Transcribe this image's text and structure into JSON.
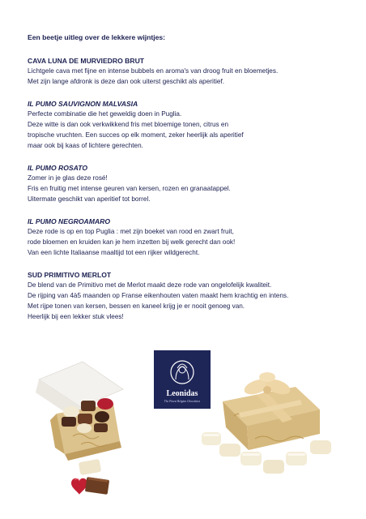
{
  "intro": "Een beetje uitleg over de lekkere wijntjes:",
  "sections": [
    {
      "title": "CAVA LUNA DE MURVIEDRO BRUT",
      "lines": [
        "Lichtgele cava met fijne en intense bubbels en aroma's van droog fruit en bloemetjes.",
        "Met zijn lange afdronk is deze dan ook uiterst geschikt als aperitief."
      ]
    },
    {
      "title": "IL PUMO SAUVIGNON MALVASIA",
      "lines": [
        "Perfecte combinatie die het geweldig doen in Puglia.",
        "Deze witte is dan ook verkwikkend fris met bloemige tonen, citrus en",
        "tropische vruchten. Een succes op elk moment, zeker heerlijk als aperitief",
        "maar ook bij kaas of lichtere gerechten."
      ]
    },
    {
      "title": "IL PUMO ROSATO",
      "lines": [
        "Zomer in je glas deze rosé!",
        "Fris en fruitig met intense geuren van kersen, rozen en granaatappel.",
        "Uitermate geschikt van aperitief tot borrel."
      ]
    },
    {
      "title": "IL PUMO NEGROAMARO",
      "lines": [
        "Deze rode is op en top Puglia : met zijn boeket van rood en zwart fruit,",
        "rode bloemen en kruiden kan je hem inzetten bij welk gerecht dan ook!",
        "Van een lichte Italiaanse maaltijd tot een rijker wildgerecht."
      ]
    },
    {
      "title": "SUD PRIMITIVO MERLOT",
      "lines": [
        "De blend van de Primitivo met de Merlot maakt deze rode van ongelofelijk kwaliteit.",
        "De rijping van 4à5 maanden op Franse eikenhouten vaten maakt hem krachtig en intens.",
        "Met rijpe tonen van kersen, bessen en kaneel krijg je er nooit genoeg van.",
        "Heerlijk bij een lekker stuk vlees!"
      ]
    }
  ],
  "logo": {
    "name": "Leonidas",
    "tagline": "The Finest Belgian Chocolates"
  },
  "colors": {
    "text": "#1b2050",
    "logo_bg": "#1e2557",
    "gold_box": "#d8bd86",
    "white_chocolate": "#f3ecd6",
    "dark_chocolate": "#4a2a1c",
    "red_heart": "#c21f33"
  }
}
